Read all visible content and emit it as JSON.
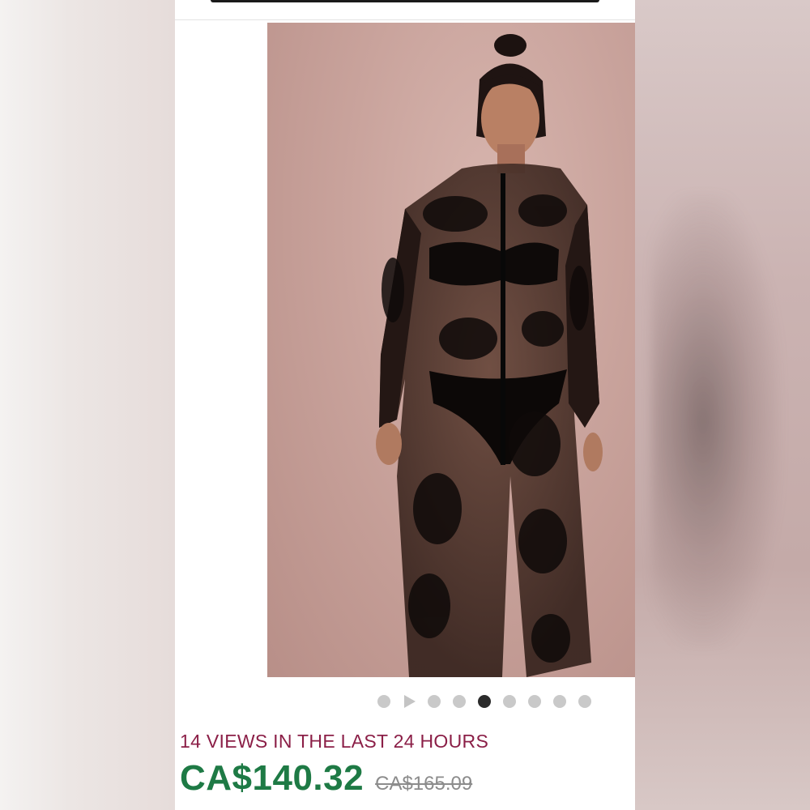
{
  "carousel": {
    "total_dots": 9,
    "active_index": 4,
    "video_indicator_index": 1
  },
  "listing": {
    "views_text": "14 VIEWS IN THE LAST 24 HOURS",
    "price": "CA$140.32",
    "original_price": "CA$165.09"
  },
  "colors": {
    "views_accent": "#8b1f47",
    "price_green": "#1e7a45",
    "strike_gray": "#8c8c8c",
    "dot_active": "#2b2b2b",
    "dot_inactive": "#c9c9c9"
  }
}
